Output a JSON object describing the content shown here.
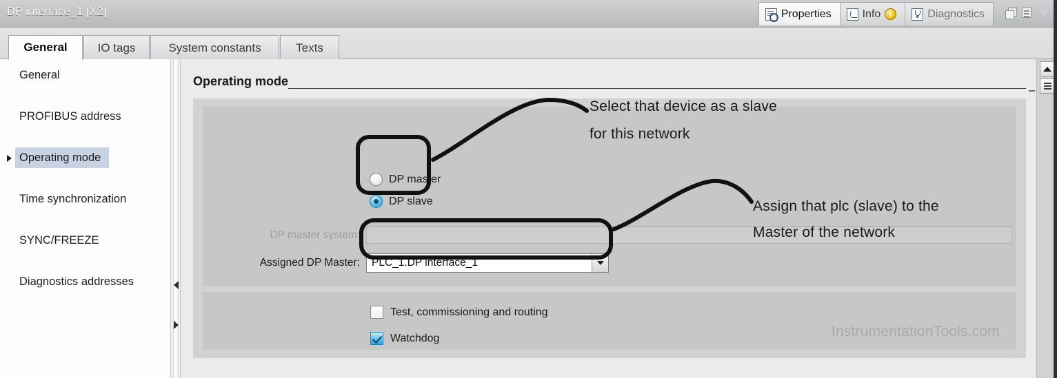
{
  "window": {
    "title": "DP interface_1 [X2]",
    "controls": [
      {
        "name": "restore-icon",
        "label": "Restore"
      },
      {
        "name": "menu-icon",
        "label": "Menu"
      },
      {
        "name": "collapse-icon",
        "label": "Collapse"
      }
    ]
  },
  "top_tabs": [
    {
      "id": "properties",
      "label": "Properties",
      "icon": "properties-icon",
      "active": true
    },
    {
      "id": "info",
      "label": "Info",
      "icon": "info-icon",
      "badge": "i",
      "active": false
    },
    {
      "id": "diagnostics",
      "label": "Diagnostics",
      "icon": "diagnostics-icon",
      "active": false
    }
  ],
  "tabs": [
    {
      "id": "general",
      "label": "General",
      "active": true
    },
    {
      "id": "io-tags",
      "label": "IO tags",
      "active": false
    },
    {
      "id": "system-constants",
      "label": "System constants",
      "active": false
    },
    {
      "id": "texts",
      "label": "Texts",
      "active": false
    }
  ],
  "sidebar": {
    "items": [
      {
        "label": "General",
        "selected": false,
        "expandable": false
      },
      {
        "label": "PROFIBUS address",
        "selected": false,
        "expandable": false
      },
      {
        "label": "Operating mode",
        "selected": true,
        "expandable": true
      },
      {
        "label": "Time synchronization",
        "selected": false,
        "expandable": false
      },
      {
        "label": "SYNC/FREEZE",
        "selected": false,
        "expandable": false
      },
      {
        "label": "Diagnostics addresses",
        "selected": false,
        "expandable": false
      }
    ]
  },
  "main": {
    "section_title": "Operating mode",
    "radios": [
      {
        "label": "DP master",
        "checked": false
      },
      {
        "label": "DP slave",
        "checked": true
      }
    ],
    "fields": [
      {
        "label": "DP master system:",
        "value": "",
        "type": "text",
        "disabled": true
      },
      {
        "label": "Assigned DP Master:",
        "value": "PLC_1.DP interface_1",
        "type": "combobox",
        "disabled": false
      }
    ],
    "checkboxes": [
      {
        "label": "Test, commissioning and routing",
        "checked": false
      },
      {
        "label": "Watchdog",
        "checked": true
      }
    ],
    "watermark": "InstrumentationTools.com"
  },
  "annotations": [
    {
      "id": "anno-slave",
      "line1": "Select that device as a slave",
      "line2": "for this network"
    },
    {
      "id": "anno-master",
      "line1": "Assign that plc (slave) to the",
      "line2": "Master of the network"
    }
  ],
  "colors": {
    "titlebar": "#c3c4c6",
    "selection": "#c7d3e3",
    "panel_outer": "#d2d2d2",
    "panel_inner": "#c7c7c7",
    "accent_blue": "#28a5dd",
    "annotation_ink": "#111111"
  }
}
